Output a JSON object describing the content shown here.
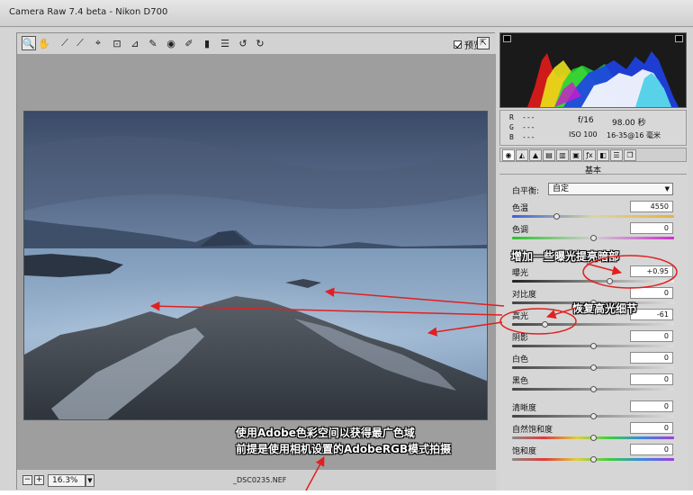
{
  "window": {
    "title": "Camera Raw 7.4 beta -  Nikon D700"
  },
  "toolbar": {
    "tools": [
      "zoom-tool",
      "hand-tool",
      "white-balance-tool",
      "color-sampler-tool",
      "targeted-adjustment-tool",
      "crop-tool",
      "straighten-tool",
      "spot-removal-tool",
      "red-eye-tool",
      "adjustment-brush-tool",
      "graduated-filter-tool",
      "open-preferences",
      "rotate-ccw",
      "rotate-cw"
    ],
    "preview_label": "预览"
  },
  "status": {
    "zoom": "16.3%",
    "filename": "_DSC0235.NEF"
  },
  "info": {
    "r_label": "R",
    "g_label": "G",
    "b_label": "B",
    "r_val": "---",
    "g_val": "---",
    "b_val": "---",
    "aperture": "f/16",
    "shutter": "98.00 秒",
    "iso": "ISO 100",
    "focal": "16-35@16 毫米"
  },
  "panel": {
    "section_title": "基本",
    "wb_label": "白平衡:",
    "wb_value": "自定",
    "sliders": [
      {
        "label": "色温",
        "value": "4550",
        "pos": 0.27
      },
      {
        "label": "色调",
        "value": "0",
        "pos": 0.5
      },
      {
        "label": "曝光",
        "value": "+0.95",
        "pos": 0.6
      },
      {
        "label": "对比度",
        "value": "0",
        "pos": 0.5
      },
      {
        "label": "高光",
        "value": "-61",
        "pos": 0.2
      },
      {
        "label": "阴影",
        "value": "0",
        "pos": 0.5
      },
      {
        "label": "白色",
        "value": "0",
        "pos": 0.5
      },
      {
        "label": "黑色",
        "value": "0",
        "pos": 0.5
      },
      {
        "label": "清晰度",
        "value": "0",
        "pos": 0.5
      },
      {
        "label": "自然饱和度",
        "value": "0",
        "pos": 0.5
      },
      {
        "label": "饱和度",
        "value": "0",
        "pos": 0.5
      }
    ]
  },
  "annotations": {
    "exposure_note": "增加一些曝光提亮暗部",
    "highlight_note": "恢复高光细节",
    "bottom_line1": "使用Adobe色彩空间以获得最广色域",
    "bottom_line2": "前提是使用相机设置的AdobeRGB模式拍摄"
  },
  "colors": {
    "annotation_red": "#e02020"
  }
}
